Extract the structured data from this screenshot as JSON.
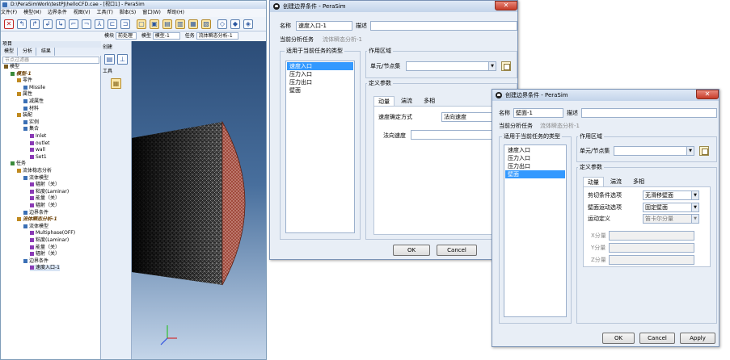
{
  "main_window": {
    "title": "D:\\PeraSimWork\\testPJ\\helloCFD.cae - [视口1] - PeraSim",
    "menu": [
      "文件(F)",
      "模型(M)",
      "边界条件",
      "视图(V)",
      "工具(T)",
      "脚本(S)",
      "窗口(W)",
      "帮助(H)"
    ],
    "toolbar2": {
      "module_label": "模块",
      "module_value": "前处理",
      "model_label": "模型",
      "model_value": "模型-1",
      "task_label": "任务",
      "task_value": "流体瞬态分析-1"
    },
    "panel": {
      "title": "项目",
      "tabs": [
        "模型",
        "分析",
        "结果"
      ],
      "filter_placeholder": "节点过滤器"
    },
    "tree": [
      {
        "text": "模型",
        "indent": 0
      },
      {
        "text": "模型-1",
        "indent": 1,
        "bold": true
      },
      {
        "text": "零件",
        "indent": 2
      },
      {
        "text": "Missile",
        "indent": 3
      },
      {
        "text": "属性",
        "indent": 2
      },
      {
        "text": "减属性",
        "indent": 3
      },
      {
        "text": "材料",
        "indent": 3
      },
      {
        "text": "装配",
        "indent": 2
      },
      {
        "text": "实例",
        "indent": 3
      },
      {
        "text": "集合",
        "indent": 3
      },
      {
        "text": "Inlet",
        "indent": 4
      },
      {
        "text": "outlet",
        "indent": 4
      },
      {
        "text": "wall",
        "indent": 4
      },
      {
        "text": "Set1",
        "indent": 4
      },
      {
        "text": "任务",
        "indent": 1
      },
      {
        "text": "流体稳态分析",
        "indent": 2
      },
      {
        "text": "流体模型",
        "indent": 3
      },
      {
        "text": "辐射（关）",
        "indent": 4
      },
      {
        "text": "粘度(Laminar)",
        "indent": 4
      },
      {
        "text": "能量（关）",
        "indent": 4
      },
      {
        "text": "辐射（关）",
        "indent": 4
      },
      {
        "text": "边界条件",
        "indent": 3
      },
      {
        "text": "流体瞬态分析-1",
        "indent": 2,
        "bold": true
      },
      {
        "text": "流体模型",
        "indent": 3
      },
      {
        "text": "Multiphase(OFF)",
        "indent": 4
      },
      {
        "text": "粘度(Laminar)",
        "indent": 4
      },
      {
        "text": "能量（关）",
        "indent": 4
      },
      {
        "text": "辐射（关）",
        "indent": 4
      },
      {
        "text": "边界条件",
        "indent": 3
      },
      {
        "text": "速度入口-1",
        "indent": 4,
        "selected": true
      }
    ],
    "toolbox": {
      "create_label": "创建",
      "tools_label": "工具"
    }
  },
  "dialog1": {
    "title": "创建边界条件 - PeraSim",
    "close_symbol": "✕",
    "name_label": "名称",
    "name_value": "速度入口-1",
    "desc_label": "描述",
    "desc_value": "",
    "task_label": "当前分析任务",
    "task_value": "流体瞬态分析-1",
    "types_group": "适用于当前任务的类型",
    "types": [
      "速度入口",
      "压力入口",
      "压力出口",
      "壁面"
    ],
    "selected_type": 0,
    "scope_group": "作用区域",
    "scope_label": "单元/节点集",
    "scope_value": "",
    "def_group": "定义参数",
    "tabs": [
      "动量",
      "湍流",
      "多相"
    ],
    "vel_method_label": "速度确定方式",
    "vel_method_value": "法向速度",
    "normal_vel_label": "法向速度",
    "normal_vel_value": "",
    "buttons": {
      "ok": "OK",
      "cancel": "Cancel"
    }
  },
  "dialog2": {
    "title": "创建边界条件 - PeraSim",
    "close_symbol": "✕",
    "name_label": "名称",
    "name_value": "壁面-1",
    "desc_label": "描述",
    "desc_value": "",
    "task_label": "当前分析任务",
    "task_value": "流体瞬态分析-1",
    "types_group": "适用于当前任务的类型",
    "types": [
      "速度入口",
      "压力入口",
      "压力出口",
      "壁面"
    ],
    "selected_type": 3,
    "scope_group": "作用区域",
    "scope_label": "单元/节点集",
    "scope_value": "",
    "def_group": "定义参数",
    "tabs": [
      "动量",
      "湍流",
      "多相"
    ],
    "shear_label": "剪切条件选项",
    "shear_value": "无滑移壁面",
    "wall_motion_label": "壁面运动选项",
    "wall_motion_value": "固定壁面",
    "motion_def_label": "运动定义",
    "motion_def_value": "笛卡尔分量",
    "comp_labels": [
      "X分量",
      "Y分量",
      "Z分量"
    ],
    "buttons": {
      "ok": "OK",
      "cancel": "Cancel",
      "apply": "Apply"
    }
  }
}
